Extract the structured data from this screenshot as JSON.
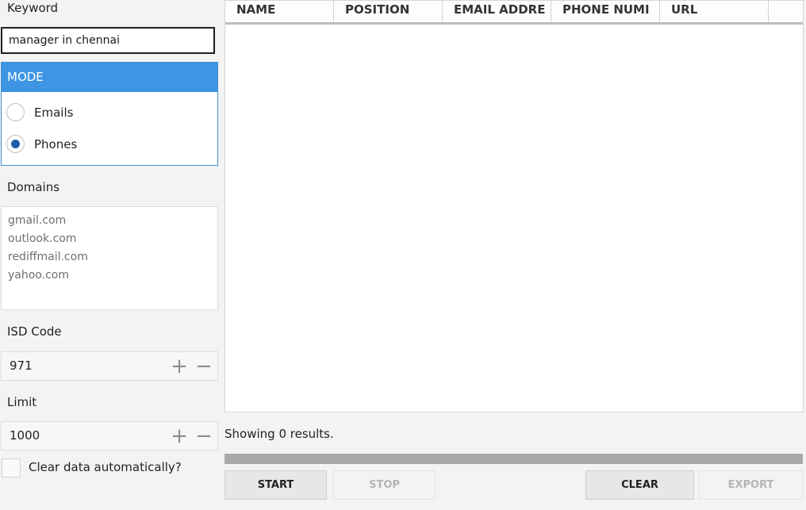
{
  "keyword": {
    "label": "Keyword",
    "value": "manager in chennai"
  },
  "mode": {
    "header": "MODE",
    "options": [
      {
        "label": "Emails",
        "selected": false
      },
      {
        "label": "Phones",
        "selected": true
      }
    ]
  },
  "domains": {
    "label": "Domains",
    "items": [
      "gmail.com",
      "outlook.com",
      "rediffmail.com",
      "yahoo.com"
    ]
  },
  "isd": {
    "label": "ISD Code",
    "value": "971",
    "increment_icon": "plus-icon",
    "decrement_icon": "minus-icon"
  },
  "limit": {
    "label": "Limit",
    "value": "1000",
    "increment_icon": "plus-icon",
    "decrement_icon": "minus-icon"
  },
  "clear_auto": {
    "label": "Clear data automatically?",
    "checked": false
  },
  "table": {
    "columns": [
      "NAME",
      "POSITION",
      "EMAIL ADDRE",
      "PHONE NUMI",
      "URL",
      ""
    ],
    "rows": []
  },
  "status": {
    "text": "Showing 0 results.",
    "progress": 0
  },
  "buttons": {
    "start": "START",
    "stop": "STOP",
    "clear": "CLEAR",
    "export": "EXPORT"
  },
  "colors": {
    "accent": "#3d95e3",
    "radio_selected": "#1a5fa8",
    "progress_track": "#a9a9a9"
  }
}
